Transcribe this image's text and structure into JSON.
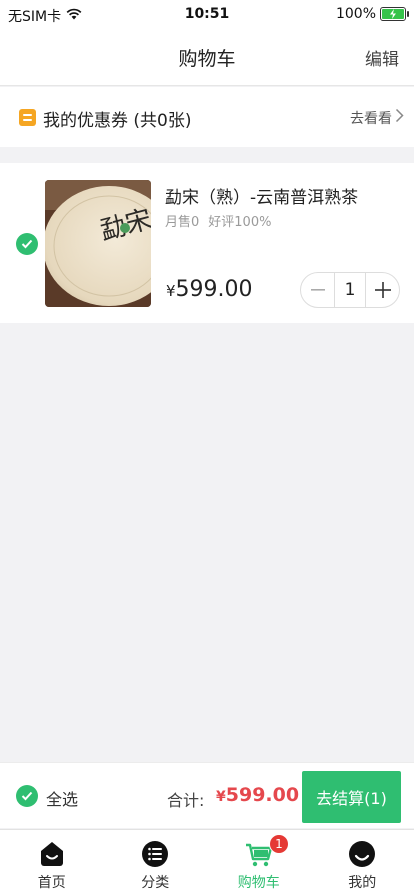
{
  "status_bar": {
    "carrier": "无SIM卡",
    "time": "10:51",
    "battery": "100%"
  },
  "nav": {
    "title": "购物车",
    "edit": "编辑"
  },
  "coupon": {
    "label": "我的优惠券 (共0张)",
    "link": "去看看"
  },
  "item": {
    "title": "勐宋（熟）-云南普洱熟茶",
    "monthly_sales": "月售0",
    "rating": "好评100%",
    "currency": "¥",
    "price": "599.00",
    "quantity": "1",
    "image_text": "勐宋"
  },
  "checkout": {
    "select_all": "全选",
    "total_label": "合计:",
    "currency": "¥",
    "total": "599.00",
    "button": "去结算(1)"
  },
  "tabs": [
    {
      "label": "首页",
      "icon": "home-icon"
    },
    {
      "label": "分类",
      "icon": "category-list-icon"
    },
    {
      "label": "购物车",
      "icon": "cart-icon",
      "badge": "1",
      "active": true
    },
    {
      "label": "我的",
      "icon": "profile-icon"
    }
  ],
  "colors": {
    "accent": "#2fbe71",
    "price_red": "#e5484d",
    "coupon_orange": "#f5a623",
    "badge_red": "#e53935"
  }
}
